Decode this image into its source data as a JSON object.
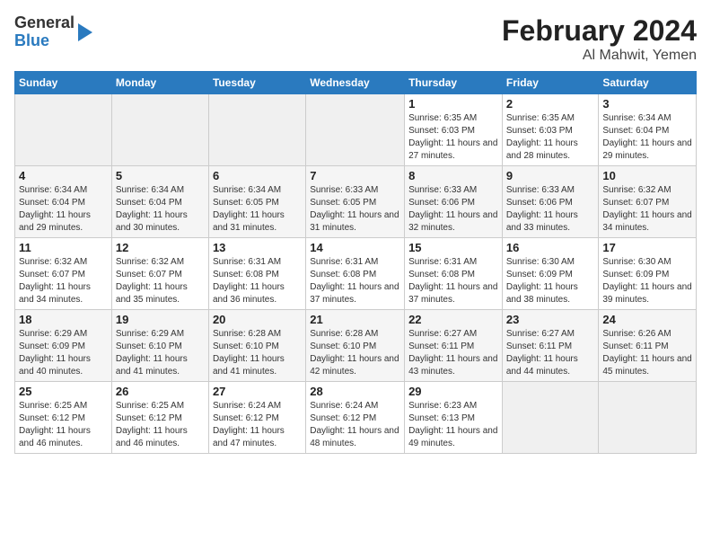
{
  "header": {
    "logo_general": "General",
    "logo_blue": "Blue",
    "title": "February 2024",
    "location": "Al Mahwit, Yemen"
  },
  "weekdays": [
    "Sunday",
    "Monday",
    "Tuesday",
    "Wednesday",
    "Thursday",
    "Friday",
    "Saturday"
  ],
  "weeks": [
    [
      {
        "day": "",
        "detail": ""
      },
      {
        "day": "",
        "detail": ""
      },
      {
        "day": "",
        "detail": ""
      },
      {
        "day": "",
        "detail": ""
      },
      {
        "day": "1",
        "detail": "Sunrise: 6:35 AM\nSunset: 6:03 PM\nDaylight: 11 hours and 27 minutes."
      },
      {
        "day": "2",
        "detail": "Sunrise: 6:35 AM\nSunset: 6:03 PM\nDaylight: 11 hours and 28 minutes."
      },
      {
        "day": "3",
        "detail": "Sunrise: 6:34 AM\nSunset: 6:04 PM\nDaylight: 11 hours and 29 minutes."
      }
    ],
    [
      {
        "day": "4",
        "detail": "Sunrise: 6:34 AM\nSunset: 6:04 PM\nDaylight: 11 hours and 29 minutes."
      },
      {
        "day": "5",
        "detail": "Sunrise: 6:34 AM\nSunset: 6:04 PM\nDaylight: 11 hours and 30 minutes."
      },
      {
        "day": "6",
        "detail": "Sunrise: 6:34 AM\nSunset: 6:05 PM\nDaylight: 11 hours and 31 minutes."
      },
      {
        "day": "7",
        "detail": "Sunrise: 6:33 AM\nSunset: 6:05 PM\nDaylight: 11 hours and 31 minutes."
      },
      {
        "day": "8",
        "detail": "Sunrise: 6:33 AM\nSunset: 6:06 PM\nDaylight: 11 hours and 32 minutes."
      },
      {
        "day": "9",
        "detail": "Sunrise: 6:33 AM\nSunset: 6:06 PM\nDaylight: 11 hours and 33 minutes."
      },
      {
        "day": "10",
        "detail": "Sunrise: 6:32 AM\nSunset: 6:07 PM\nDaylight: 11 hours and 34 minutes."
      }
    ],
    [
      {
        "day": "11",
        "detail": "Sunrise: 6:32 AM\nSunset: 6:07 PM\nDaylight: 11 hours and 34 minutes."
      },
      {
        "day": "12",
        "detail": "Sunrise: 6:32 AM\nSunset: 6:07 PM\nDaylight: 11 hours and 35 minutes."
      },
      {
        "day": "13",
        "detail": "Sunrise: 6:31 AM\nSunset: 6:08 PM\nDaylight: 11 hours and 36 minutes."
      },
      {
        "day": "14",
        "detail": "Sunrise: 6:31 AM\nSunset: 6:08 PM\nDaylight: 11 hours and 37 minutes."
      },
      {
        "day": "15",
        "detail": "Sunrise: 6:31 AM\nSunset: 6:08 PM\nDaylight: 11 hours and 37 minutes."
      },
      {
        "day": "16",
        "detail": "Sunrise: 6:30 AM\nSunset: 6:09 PM\nDaylight: 11 hours and 38 minutes."
      },
      {
        "day": "17",
        "detail": "Sunrise: 6:30 AM\nSunset: 6:09 PM\nDaylight: 11 hours and 39 minutes."
      }
    ],
    [
      {
        "day": "18",
        "detail": "Sunrise: 6:29 AM\nSunset: 6:09 PM\nDaylight: 11 hours and 40 minutes."
      },
      {
        "day": "19",
        "detail": "Sunrise: 6:29 AM\nSunset: 6:10 PM\nDaylight: 11 hours and 41 minutes."
      },
      {
        "day": "20",
        "detail": "Sunrise: 6:28 AM\nSunset: 6:10 PM\nDaylight: 11 hours and 41 minutes."
      },
      {
        "day": "21",
        "detail": "Sunrise: 6:28 AM\nSunset: 6:10 PM\nDaylight: 11 hours and 42 minutes."
      },
      {
        "day": "22",
        "detail": "Sunrise: 6:27 AM\nSunset: 6:11 PM\nDaylight: 11 hours and 43 minutes."
      },
      {
        "day": "23",
        "detail": "Sunrise: 6:27 AM\nSunset: 6:11 PM\nDaylight: 11 hours and 44 minutes."
      },
      {
        "day": "24",
        "detail": "Sunrise: 6:26 AM\nSunset: 6:11 PM\nDaylight: 11 hours and 45 minutes."
      }
    ],
    [
      {
        "day": "25",
        "detail": "Sunrise: 6:25 AM\nSunset: 6:12 PM\nDaylight: 11 hours and 46 minutes."
      },
      {
        "day": "26",
        "detail": "Sunrise: 6:25 AM\nSunset: 6:12 PM\nDaylight: 11 hours and 46 minutes."
      },
      {
        "day": "27",
        "detail": "Sunrise: 6:24 AM\nSunset: 6:12 PM\nDaylight: 11 hours and 47 minutes."
      },
      {
        "day": "28",
        "detail": "Sunrise: 6:24 AM\nSunset: 6:12 PM\nDaylight: 11 hours and 48 minutes."
      },
      {
        "day": "29",
        "detail": "Sunrise: 6:23 AM\nSunset: 6:13 PM\nDaylight: 11 hours and 49 minutes."
      },
      {
        "day": "",
        "detail": ""
      },
      {
        "day": "",
        "detail": ""
      }
    ]
  ]
}
